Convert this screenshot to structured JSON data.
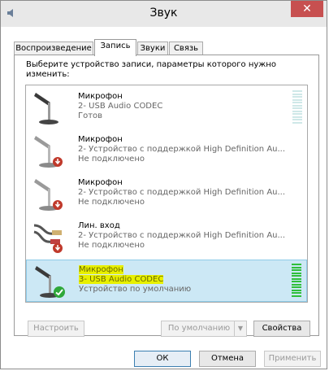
{
  "window": {
    "title": "Звук",
    "close_glyph": "✕"
  },
  "tabs": [
    {
      "label": "Воспроизведение",
      "active": false
    },
    {
      "label": "Запись",
      "active": true
    },
    {
      "label": "Звуки",
      "active": false
    },
    {
      "label": "Связь",
      "active": false
    }
  ],
  "instruction": "Выберите устройство записи, параметры которого нужно изменить:",
  "devices": [
    {
      "name": "Микрофон",
      "description": "2- USB Audio CODEC",
      "status": "Готов",
      "icon": "microphone-icon",
      "badge": null,
      "selected": false,
      "level": 0
    },
    {
      "name": "Микрофон",
      "description": "2- Устройство с поддержкой High Definition Au...",
      "status": "Не подключено",
      "icon": "microphone-icon",
      "badge": "disconnected-icon",
      "selected": false,
      "level": 0
    },
    {
      "name": "Микрофон",
      "description": "2- Устройство с поддержкой High Definition Au...",
      "status": "Не подключено",
      "icon": "microphone-icon",
      "badge": "disconnected-icon",
      "selected": false,
      "level": 0
    },
    {
      "name": "Лин. вход",
      "description": "2- Устройство с поддержкой High Definition Au...",
      "status": "Не подключено",
      "icon": "line-in-cable-icon",
      "badge": "disconnected-icon",
      "selected": false,
      "level": 0
    },
    {
      "name": "Микрофон",
      "description": "3- USB Audio CODEC",
      "status": "Устройство по умолчанию",
      "icon": "microphone-icon",
      "badge": "default-checkmark-icon",
      "selected": true,
      "level": 1
    }
  ],
  "buttons": {
    "configure": "Настроить",
    "set_default": "По умолчанию",
    "properties": "Свойства",
    "ok": "ОК",
    "cancel": "Отмена",
    "apply": "Применить"
  },
  "colors": {
    "selection_bg": "#cce8f5",
    "highlight": "#e8f000",
    "level_on": "#2fbf3a",
    "close_button": "#c75050"
  }
}
